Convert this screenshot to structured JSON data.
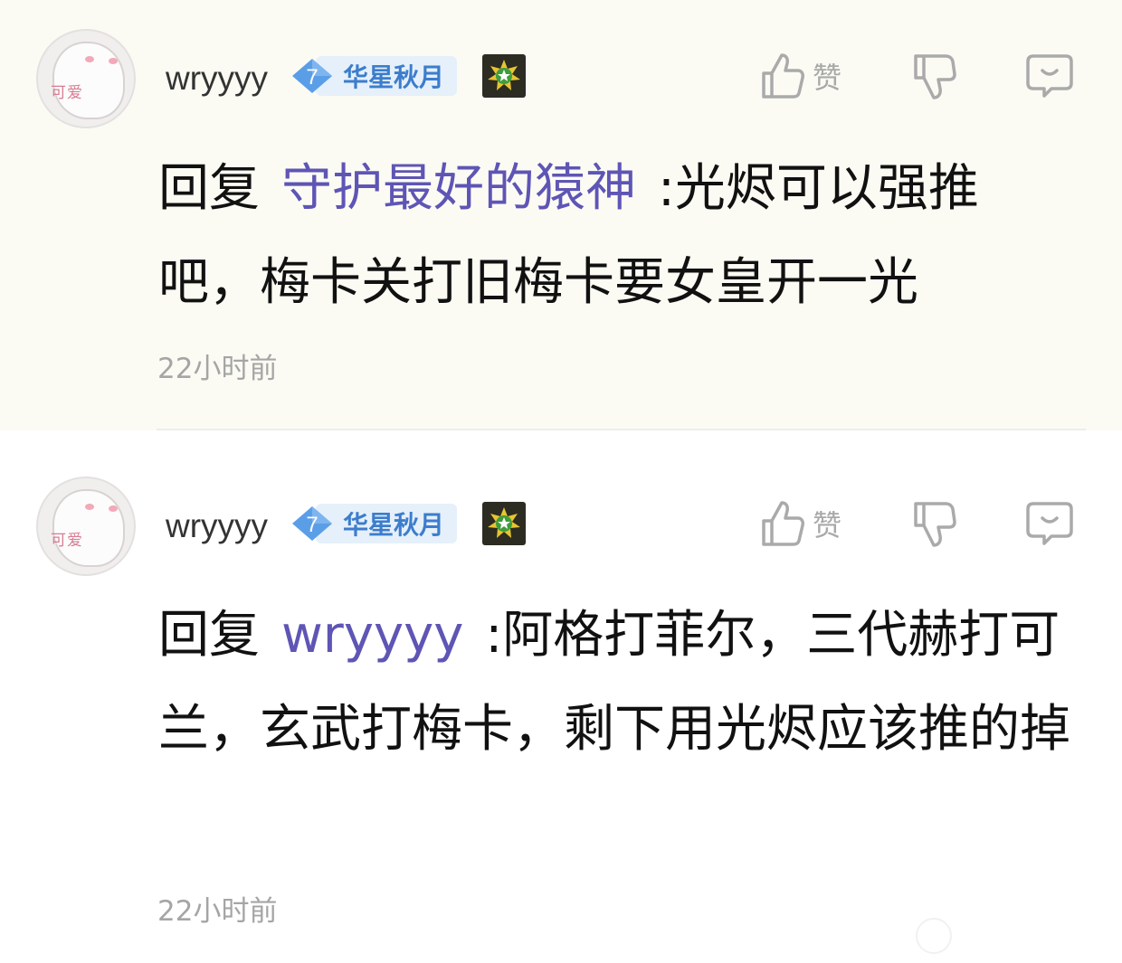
{
  "comments": [
    {
      "avatar": {
        "icon": "avatar-cartoon",
        "tag": "可爱"
      },
      "username": "wryyyy",
      "level": {
        "number": "7",
        "title": "华星秋月"
      },
      "medal_icon": "star-medal-icon",
      "like_label": "赞",
      "reply_prefix": "回复",
      "reply_target": "守护最好的猿神",
      "text": ":光烬可以强推吧，梅卡关打旧梅卡要女皇开一光",
      "time": "22小时前"
    },
    {
      "avatar": {
        "icon": "avatar-cartoon",
        "tag": "可爱"
      },
      "username": "wryyyy",
      "level": {
        "number": "7",
        "title": "华星秋月"
      },
      "medal_icon": "star-medal-icon",
      "like_label": "赞",
      "reply_prefix": "回复",
      "reply_target": "wryyyy",
      "text": ":阿格打菲尔，三代赫打可兰，玄武打梅卡，剩下用光烬应该推的掉",
      "time": "22小时前"
    }
  ],
  "colors": {
    "highlight_bg": "#fbfbf4",
    "reply_target": "#5e55b5",
    "level_blue": "#3c7dcc",
    "muted": "#a5a5a5"
  }
}
